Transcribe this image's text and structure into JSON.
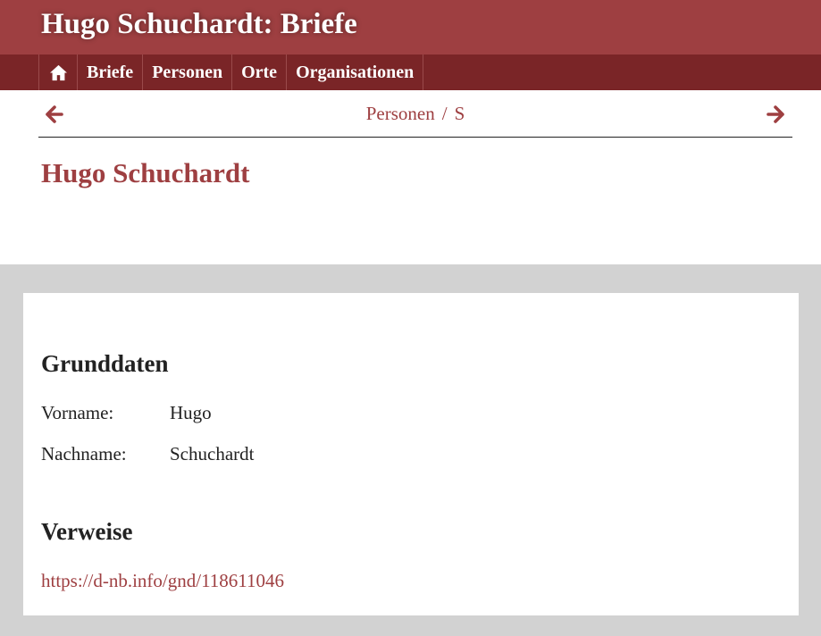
{
  "header": {
    "title": "Hugo Schuchardt: Briefe"
  },
  "nav": {
    "home_icon": "home-icon",
    "items": [
      {
        "label": "Briefe"
      },
      {
        "label": "Personen"
      },
      {
        "label": "Orte"
      },
      {
        "label": "Organisationen"
      }
    ]
  },
  "pager": {
    "prev_icon": "arrow-left-icon",
    "next_icon": "arrow-right-icon",
    "breadcrumb": [
      "Personen",
      "S"
    ],
    "separator": "/"
  },
  "page": {
    "title": "Hugo Schuchardt"
  },
  "grunddaten": {
    "heading": "Grunddaten",
    "fields": [
      {
        "label": "Vorname:",
        "value": "Hugo"
      },
      {
        "label": "Nachname:",
        "value": "Schuchardt"
      }
    ]
  },
  "verweise": {
    "heading": "Verweise",
    "links": [
      "https://d-nb.info/gnd/118611046"
    ]
  },
  "colors": {
    "brand": "#9e3f41",
    "nav_bg": "#7a2527",
    "page_bg": "#d2d2d2",
    "text": "#222222"
  }
}
